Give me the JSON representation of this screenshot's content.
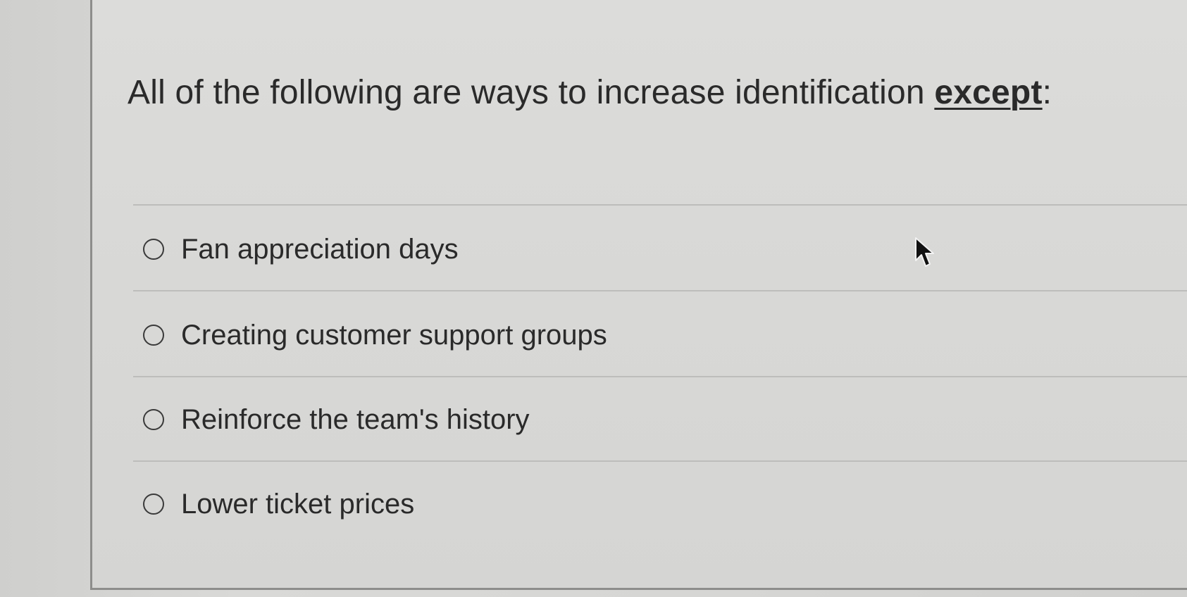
{
  "question": {
    "prefix": "All of the following are ways to increase identification ",
    "emphasis": "except",
    "suffix": ":"
  },
  "answers": [
    {
      "label": "Fan appreciation days",
      "selected": false
    },
    {
      "label": "Creating customer support groups",
      "selected": false
    },
    {
      "label": "Reinforce the team's history",
      "selected": false
    },
    {
      "label": "Lower ticket prices",
      "selected": false
    }
  ],
  "icons": {
    "radio": "radio-unselected-icon",
    "cursor": "mouse-pointer-icon"
  },
  "colors": {
    "text": "#2a2a2a",
    "divider": "#bdbdbb",
    "border": "#8d8d8b"
  }
}
